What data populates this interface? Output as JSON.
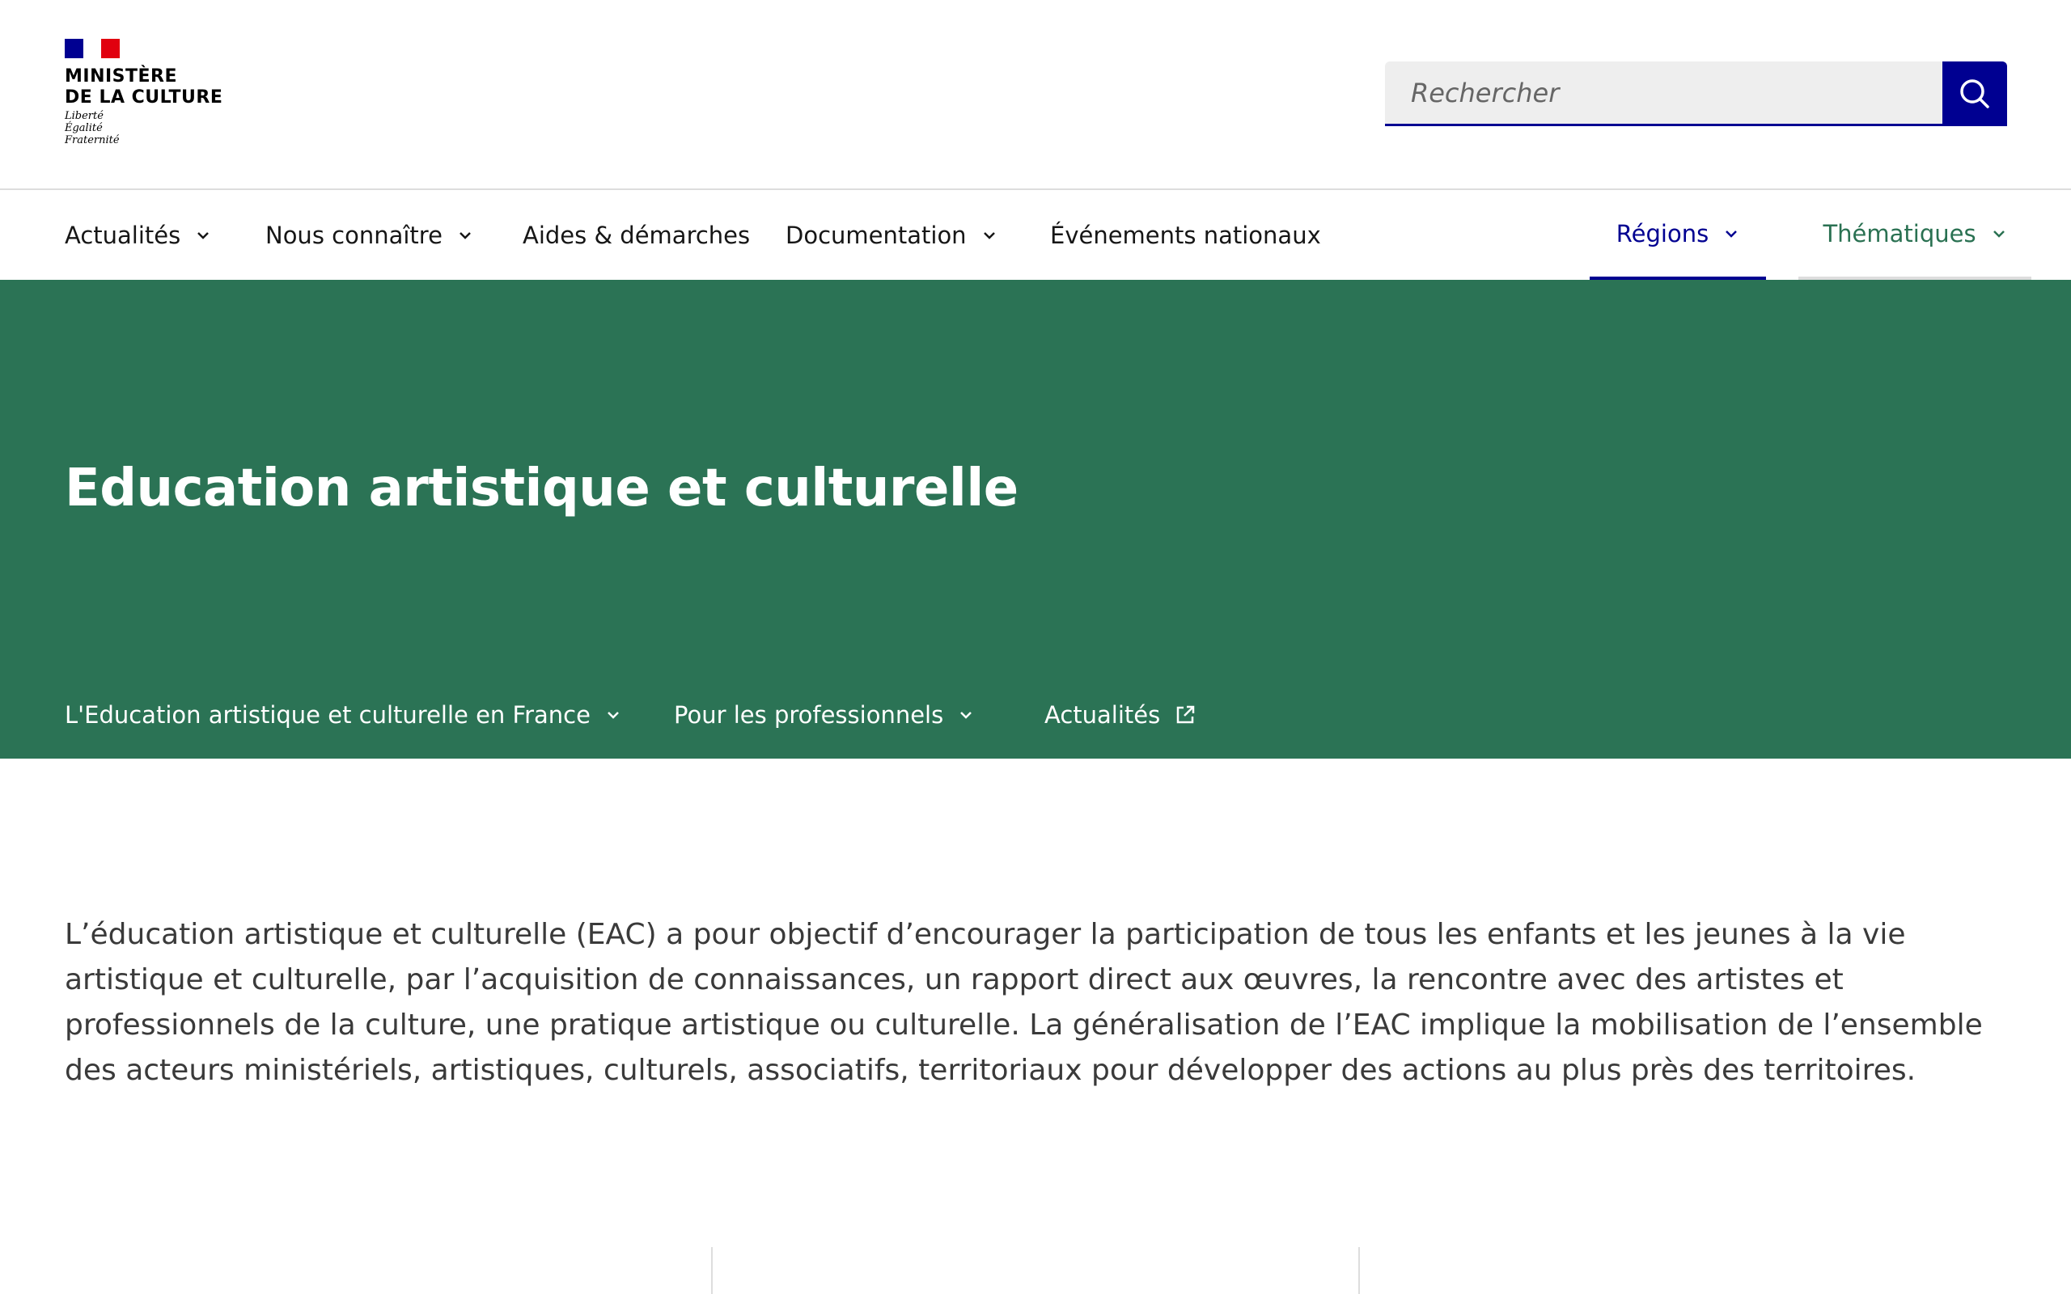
{
  "header": {
    "logo": {
      "title_line1": "MINISTÈRE",
      "title_line2": "DE LA CULTURE",
      "motto_line1": "Liberté",
      "motto_line2": "Égalité",
      "motto_line3": "Fraternité",
      "flag_colors": [
        "#000091",
        "#ffffff",
        "#e1000f"
      ]
    },
    "search": {
      "placeholder": "Rechercher",
      "button_icon": "search-icon",
      "accent": "#000091"
    }
  },
  "nav": {
    "items": [
      {
        "label": "Actualités",
        "dropdown": true
      },
      {
        "label": "Nous connaître",
        "dropdown": true
      },
      {
        "label": "Aides & démarches",
        "dropdown": false
      },
      {
        "label": "Documentation",
        "dropdown": true
      },
      {
        "label": "Événements nationaux",
        "dropdown": false
      }
    ],
    "regions": {
      "label": "Régions",
      "color": "#000091"
    },
    "thematiques": {
      "label": "Thématiques",
      "color": "#2a7152"
    }
  },
  "hero": {
    "title": "Education artistique et culturelle",
    "background": "#2b7355",
    "subnav": [
      {
        "label": "L'Education artistique et culturelle en France",
        "icon": "chevron-down-icon"
      },
      {
        "label": "Pour les professionnels",
        "icon": "chevron-down-icon"
      },
      {
        "label": "Actualités",
        "icon": "external-link-icon"
      }
    ]
  },
  "main": {
    "intro": "L’éducation artistique et culturelle (EAC) a pour objectif d’encourager la participation de tous les enfants et les jeunes à la vie artistique et culturelle, par l’acquisition de connaissances, un rapport direct aux œuvres, la rencontre avec des artistes et professionnels de la culture, une pratique artistique ou culturelle. La généralisation de l’EAC implique la mobilisation de l’ensemble des acteurs ministériels, artistiques, culturels, associatifs, territoriaux pour développer des actions au plus près des territoires."
  }
}
